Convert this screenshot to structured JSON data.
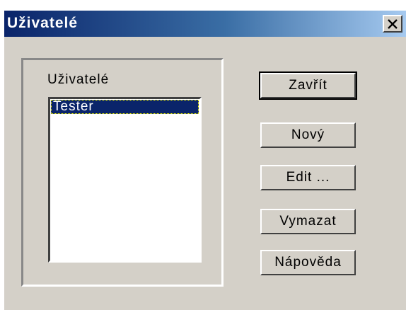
{
  "window": {
    "title": "Uživatelé",
    "close_icon": "close-x-icon"
  },
  "users_group": {
    "label": "Uživatelé",
    "items": [
      {
        "label": "Tester",
        "selected": true
      }
    ]
  },
  "buttons": {
    "close": "Zavřít",
    "new": "Nový",
    "edit": "Edit ...",
    "delete": "Vymazat",
    "help": "Nápověda"
  },
  "colors": {
    "title_start": "#0a246a",
    "title_end": "#a6caf0",
    "selection": "#0a246a",
    "dialog_face": "#d4d0c8"
  }
}
